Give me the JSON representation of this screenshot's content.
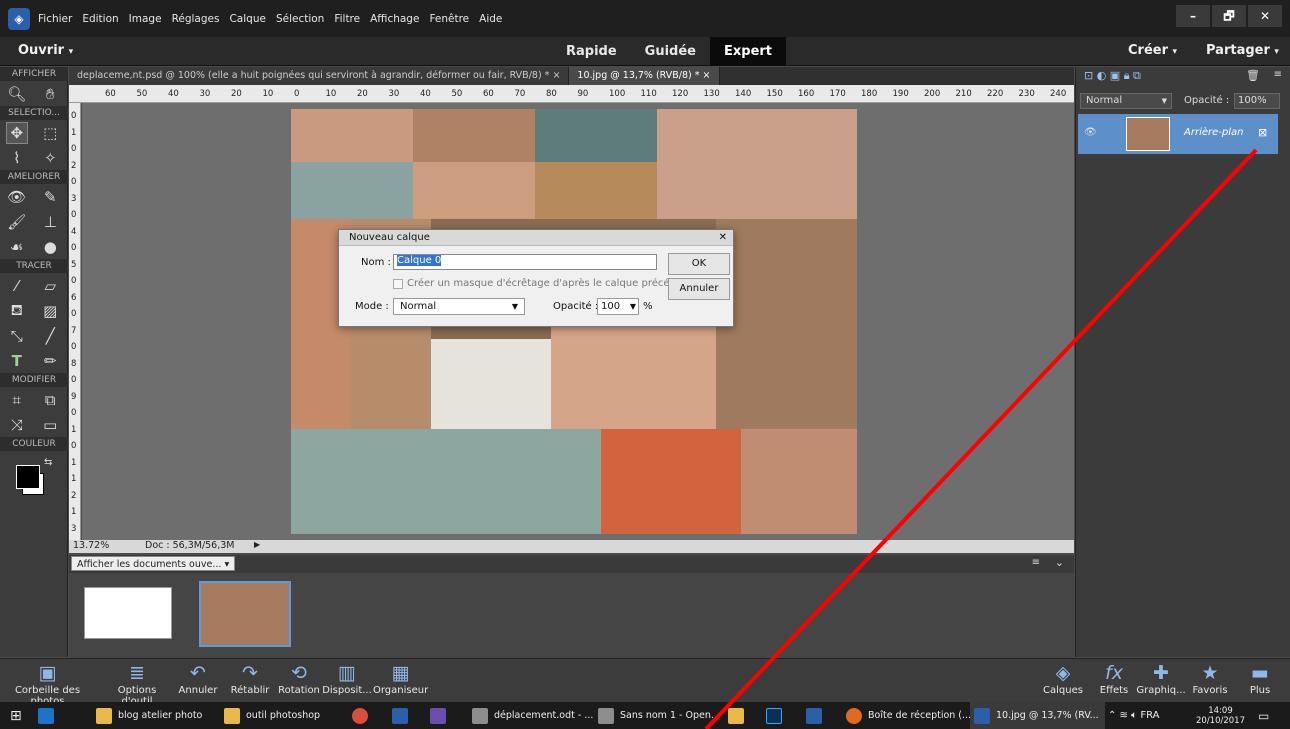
{
  "menu": {
    "items": [
      "Fichier",
      "Edition",
      "Image",
      "Réglages",
      "Calque",
      "Sélection",
      "Filtre",
      "Affichage",
      "Fenêtre",
      "Aide"
    ]
  },
  "window_buttons": [
    "–",
    "🗗",
    "✕"
  ],
  "modebar": {
    "open": "Ouvrir",
    "modes": [
      "Rapide",
      "Guidée",
      "Expert"
    ],
    "active_mode": "Expert",
    "create": "Créer",
    "share": "Partager"
  },
  "toolbox": {
    "sections": [
      "AFFICHER",
      "SELECTIO...",
      "AMELIORER",
      "TRACER",
      "MODIFIER",
      "COULEUR"
    ]
  },
  "doc_tabs": [
    {
      "label": "deplaceme,nt.psd @ 100% (elle a huit poignées qui serviront à agrandir, déformer ou fair, RVB/8) *",
      "close": "×"
    },
    {
      "label": "10.jpg @ 13,7% (RVB/8) *",
      "close": "×"
    }
  ],
  "ruler_h": [
    "60",
    "50",
    "40",
    "30",
    "20",
    "10",
    "0",
    "10",
    "20",
    "30",
    "40",
    "50",
    "60",
    "70",
    "80",
    "90",
    "100",
    "110",
    "120",
    "130",
    "140",
    "150",
    "160",
    "170",
    "180",
    "190",
    "200",
    "210",
    "220",
    "230",
    "240"
  ],
  "ruler_v": [
    "0",
    "1",
    "0",
    "2",
    "0",
    "3",
    "0",
    "4",
    "0",
    "5",
    "0",
    "6",
    "0",
    "7",
    "0",
    "8",
    "0",
    "9",
    "0",
    "1",
    "0",
    "1",
    "1",
    "2",
    "1",
    "3"
  ],
  "status": {
    "zoom": "13.72%",
    "doc": "Doc : 56,3M/56,3M"
  },
  "bin": {
    "select_label": "Afficher les documents ouve..."
  },
  "layers_panel": {
    "blend_mode": "Normal",
    "opacity_label": "Opacité :",
    "opacity_value": "100%",
    "layer_name": "Arrière-plan"
  },
  "dialog": {
    "title": "Nouveau calque",
    "name_label": "Nom :",
    "name_value": "Calque 0",
    "ok": "OK",
    "cancel": "Annuler",
    "clip_label": "Créer un masque d'écrêtage d'après le calque précédent",
    "mode_label": "Mode :",
    "mode_value": "Normal",
    "opacity_label": "Opacité :",
    "opacity_value": "100",
    "percent": "%"
  },
  "bottom_left": [
    "Corbeille des photos",
    "Options d'outil",
    "Annuler",
    "Rétablir",
    "Rotation",
    "Disposit...",
    "Organiseur"
  ],
  "bottom_right": [
    "Calques",
    "Effets",
    "Graphiq...",
    "Favoris",
    "Plus"
  ],
  "taskbar": {
    "items": [
      "blog atelier photo",
      "outil photoshop",
      "déplacement.odt - ...",
      "Sans nom 1 - Open...",
      "Boîte de réception (...",
      "10.jpg @ 13,7% (RV..."
    ],
    "lang": "FRA",
    "time": "14:09",
    "date": "20/10/2017"
  },
  "colors": {
    "accent": "#5d8fc9",
    "annotation": "#ff0000"
  }
}
